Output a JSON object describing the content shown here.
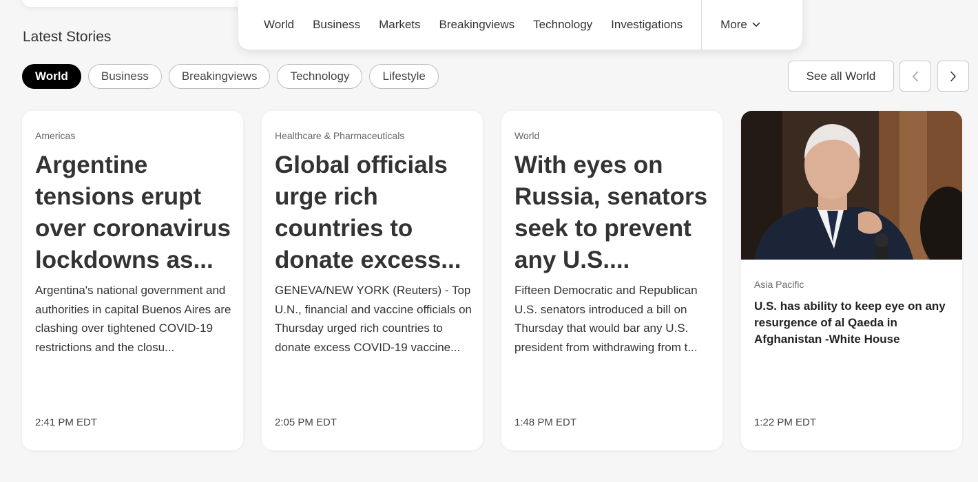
{
  "nav": {
    "items": [
      "World",
      "Business",
      "Markets",
      "Breakingviews",
      "Technology",
      "Investigations"
    ],
    "more_label": "More"
  },
  "section": {
    "title": "Latest Stories"
  },
  "filters": {
    "chips": [
      "World",
      "Business",
      "Breakingviews",
      "Technology",
      "Lifestyle"
    ],
    "active": "World",
    "see_all_label": "See all World"
  },
  "cards": [
    {
      "kicker": "Americas",
      "headline": "Argentine tensions erupt over coronavirus lockdowns as...",
      "summary": "Argentina's national government and authorities in capital Buenos Aires are clashing over tightened COVID-19 restrictions and the closu...",
      "time": "2:41 PM EDT"
    },
    {
      "kicker": "Healthcare & Pharmaceuticals",
      "headline": "Global officials urge rich countries to donate excess...",
      "summary": "GENEVA/NEW YORK (Reuters) - Top U.N., financial and vaccine officials on Thursday urged rich countries to donate excess COVID-19 vaccine...",
      "time": "2:05 PM EDT"
    },
    {
      "kicker": "World",
      "headline": "With eyes on Russia, senators seek to prevent any U.S....",
      "summary": "Fifteen Democratic and Republican U.S. senators introduced a bill on Thursday that would bar any U.S. president from withdrawing from t...",
      "time": "1:48 PM EDT"
    },
    {
      "kicker": "Asia Pacific",
      "headline": "U.S. has ability to keep eye on any resurgence of al Qaeda in Afghanistan -White House",
      "time": "1:22 PM EDT"
    }
  ],
  "colors": {
    "background": "#f6f6f6",
    "active_chip": "#000000",
    "text": "#333333"
  },
  "icons": {
    "more": "chevron-down-icon",
    "prev": "chevron-left-icon",
    "next": "chevron-right-icon"
  }
}
